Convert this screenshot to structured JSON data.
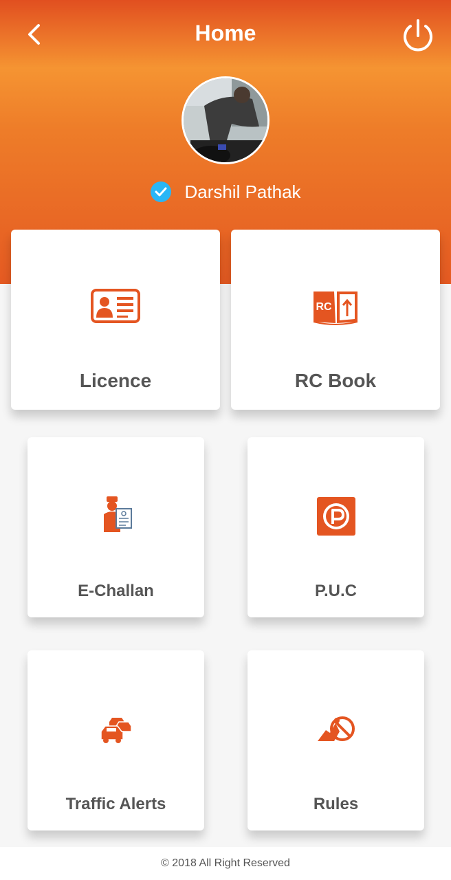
{
  "header": {
    "title": "Home",
    "back_icon": "chevron-left-icon",
    "power_icon": "power-icon"
  },
  "profile": {
    "name": "Darshil Pathak",
    "verified_icon": "verified-check-icon",
    "avatar": "profile-photo"
  },
  "tiles": [
    {
      "label": "Licence",
      "icon": "id-card-icon"
    },
    {
      "label": "RC Book",
      "icon": "rc-book-icon"
    },
    {
      "label": "E-Challan",
      "icon": "traffic-officer-icon"
    },
    {
      "label": "P.U.C",
      "icon": "puc-logo-icon"
    },
    {
      "label": "Traffic Alerts",
      "icon": "traffic-cars-icon"
    },
    {
      "label": "Rules",
      "icon": "rules-icon"
    }
  ],
  "footer": {
    "text": "© 2018 All Right Reserved"
  },
  "colors": {
    "accent": "#e45521",
    "gradient_light": "#f59432",
    "text_gray": "#555555",
    "verified_blue": "#29b6f6"
  }
}
